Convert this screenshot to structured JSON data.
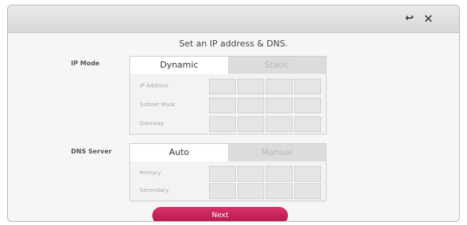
{
  "window": {
    "back_icon": "back-arrow-icon",
    "back_glyph": "↩",
    "close_icon": "close-icon",
    "close_glyph": "✕"
  },
  "heading": "Set an IP address & DNS.",
  "ip_mode": {
    "label": "IP Mode",
    "tabs": [
      "Dynamic",
      "Static"
    ],
    "active_tab": "Dynamic",
    "fields": [
      "IP Address",
      "Subnet Mask",
      "Gateway"
    ]
  },
  "dns_server": {
    "label": "DNS Server",
    "tabs": [
      "Auto",
      "Manual"
    ],
    "active_tab": "Auto",
    "fields": [
      "Primary",
      "Secondary"
    ]
  },
  "next_label": "Next",
  "colors": {
    "accent": "#c21f5a",
    "background": "#f6f6f6"
  }
}
